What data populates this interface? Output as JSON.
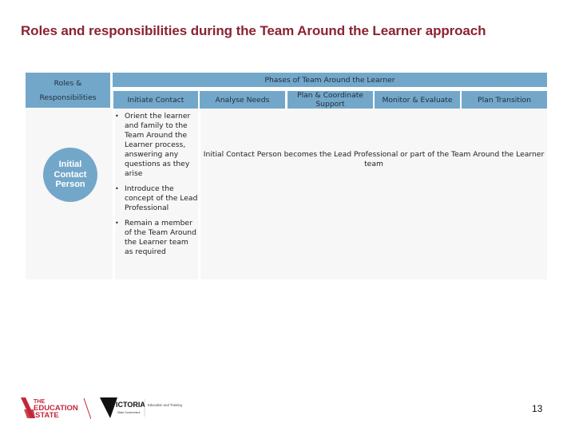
{
  "title": "Roles and responsibilities during the Team Around the Learner approach",
  "table": {
    "roles_header_line1": "Roles &",
    "roles_header_line2": "Responsibilities",
    "phases_header": "Phases of Team Around the Learner",
    "phases": [
      {
        "label": "Initiate Contact"
      },
      {
        "label": "Analyse Needs"
      },
      {
        "label": "Plan & Coordinate Support"
      },
      {
        "label": "Monitor & Evaluate"
      },
      {
        "label": "Plan Transition"
      }
    ],
    "role": {
      "label": "Initial Contact Person",
      "initiate_contact_tasks": [
        "Orient the learner and family to the Team Around the Learner process, answering any questions as they arise",
        "Introduce the concept of the Lead Professional",
        "Remain a member of the Team Around the Learner team as required"
      ],
      "later_phases_outcome": "Initial Contact Person becomes the Lead Professional or part of the Team Around the Learner team"
    }
  },
  "footer": {
    "logo_education_state": {
      "line1": "THE",
      "line2": "EDUCATION",
      "line3": "STATE"
    },
    "logo_victoria": {
      "name": "VICTORIA",
      "sub": "State Government",
      "dept": "Education and Training"
    },
    "page_number": "13"
  },
  "colors": {
    "title": "#8b2332",
    "header_fill": "#73a7ca",
    "body_fill": "#f7f7f7",
    "brand_red": "#c0283b"
  }
}
